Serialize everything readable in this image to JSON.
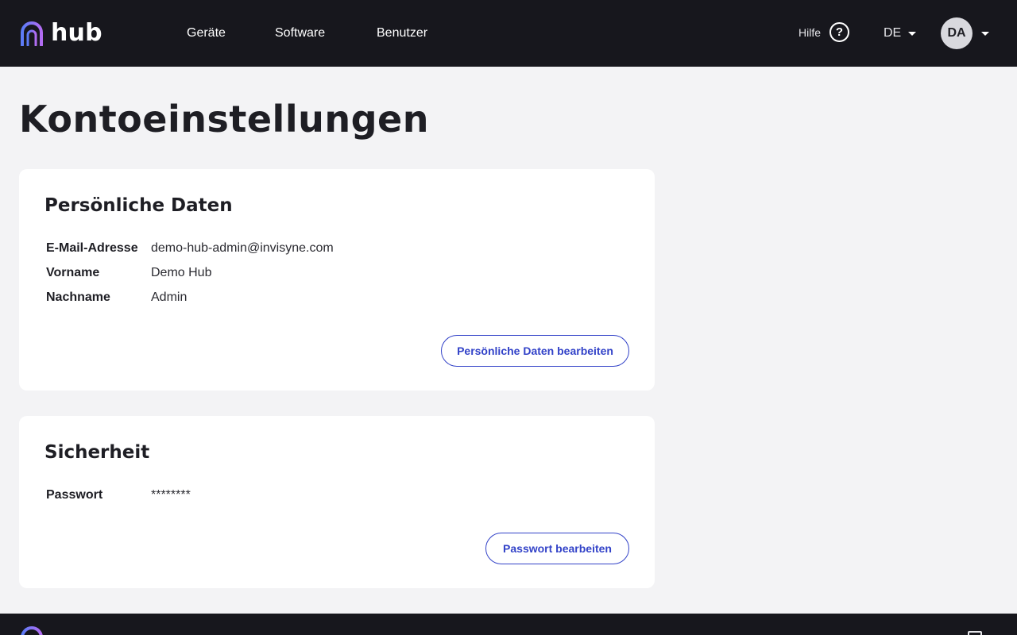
{
  "header": {
    "logo_text": "hub",
    "nav": [
      "Geräte",
      "Software",
      "Benutzer"
    ],
    "help_label": "Hilfe",
    "help_icon": "?",
    "language": "DE",
    "avatar_initials": "DA"
  },
  "page": {
    "title": "Kontoeinstellungen"
  },
  "personal": {
    "title": "Persönliche Daten",
    "rows": [
      {
        "label": "E-Mail-Adresse",
        "value": "demo-hub-admin@invisyne.com"
      },
      {
        "label": "Vorname",
        "value": "Demo Hub"
      },
      {
        "label": "Nachname",
        "value": "Admin"
      }
    ],
    "edit_button": "Persönliche Daten bearbeiten"
  },
  "security": {
    "title": "Sicherheit",
    "rows": [
      {
        "label": "Passwort",
        "value": "********"
      }
    ],
    "edit_button": "Passwort bearbeiten"
  },
  "colors": {
    "topbar": "#17171d",
    "accent": "#3242c8",
    "logo_gradient_start": "#5b7cf7",
    "logo_gradient_end": "#b36cf2"
  }
}
